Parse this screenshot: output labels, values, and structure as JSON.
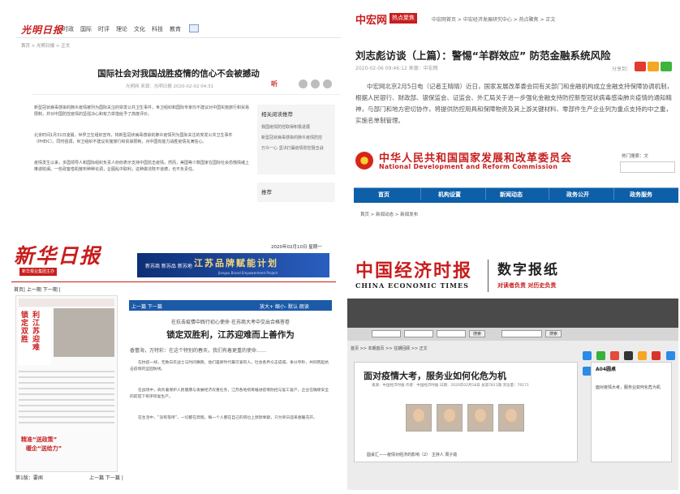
{
  "q1": {
    "logo": "光明日报",
    "nav": [
      "时政",
      "国际",
      "时评",
      "理论",
      "文化",
      "科技",
      "教育"
    ],
    "breadcrumb": "首页 > 光明日报 > 正文",
    "title": "国际社会对我国战胜疫情的信心不会被撼动",
    "meta": "光明网   来源：光明日报   2020-02-02 04:31",
    "listen": "听",
    "body": [
      "新型冠状病毒感染的肺炎疫情被列为国际关注的突发公共卫生事件，世卫组织和国际专家均不建议对中国实施旅行和贸易限制，并对中国防控疫情的坚强决心和有力举措给予了高度评价。",
      "北京时间1月31日凌晨，世界卫生组织宣布，将新型冠状病毒感染的肺炎疫情列为国际关注的突发公共卫生事件（PHEIC）。同时强调，世卫组织不建议实施旅行和贸易限制，对中国有能力战胜疫情充满信心。",
      "疫情发生以来，多国领导人和国际组织负责人纷纷表示支持中国抗击疫情。然而，美国等少数国家在国际社会恐慌情绪上推波助澜。一些政客借机散布种种论调，企图乱中取利，这种做法既不道德，也不负责任。"
    ],
    "sidebar_title": "相关阅读推荐",
    "sidebar_items": [
      "我国疫情防控取得积极进展",
      "新型冠状病毒感染的肺炎疫情防控",
      "万众一心 坚决打赢疫情防控阻击战"
    ],
    "sidebar_title2": "推荐"
  },
  "q2": {
    "logo": "中宏网",
    "hot_badge": "热点聚焦",
    "breadcrumb": "中宏网首页 > 中宏经济发展研究中心 > 热点聚焦 > 正文",
    "title": "刘志彪访谈（上篇）：警惕“羊群效应” 防范金融系统风险",
    "meta": "2020-02-06 09:46:12   来源：中宏网",
    "share_label": "分享到：",
    "paragraph": "中宏网北京2月5日电（记者王晴晴）近日，国家发展改革委会同有关部门和金融机构成立金融支持保障协调机制，根据人民银行、财政部、银保监会、证监会、外汇局关于进一步强化金融支持防控新型冠状病毒感染肺炎疫情的通知精神，与部门和地方密切协作，将提供防控用具和保障物资及其上游关键材料、零部件生产企业列为重点支持的中之重，实施名单制管理。",
    "ndrc_cn": "中华人民共和国国家发展和改革委员会",
    "ndrc_en": "National Development and Reform Commission",
    "hot_search": "热门搜索：文",
    "nav": [
      "首页",
      "机构设置",
      "新闻动态",
      "政务公开",
      "政务服务"
    ],
    "breadcrumb2": "首页 > 新闻动态 > 新闻发布"
  },
  "q3": {
    "logo": "新华日报",
    "logo_sub": "新华报业集团主办",
    "date": "2020年02月10日  星期一",
    "ad_title": "江苏品牌赋能计划",
    "ad_left": "新苏商  新苏品  新苏地",
    "ad_sub": "Jiangsu Brand Empowerment Project",
    "page_nav": "首页| 上一期  下一期 |",
    "thumb_title1": "锁定双胜",
    "thumb_title2": "利江苏迎难",
    "thumb_bottom1": "精准“送政策”",
    "thumb_bottom2": "暖企“送给力”",
    "article_nav_left": "上一篇  下一篇",
    "article_nav_right": "放大+  缩小-  默认  朗读",
    "kicker": "在抗击疫情中践行初心使命  在苏商大考中交出合格答卷",
    "title": "锁定双胜利，江苏迎难而上善作为",
    "author": "香蕾海，万特彩：在这个特别的春天，我们有着更重的使命……",
    "paras": [
      "在抗疫一线，无数白衣战士与时间赛跑，他们是新时代最可爱的人。社会各界众志成城，争分夺秒，共同筑起抗击疫情的坚固防线。",
      "在战场中，肩负着保护人民健康与发展经济双重任务，江苏各地统筹推进疫情防控与复工复产，企业在确保安全的前提下有序恢复生产。",
      "在生活中，“没有等待”，一切都在奔跑。每一个人都在自己的岗位上默默奉献，只为早日迎来春暖花开。"
    ],
    "footer_left": "第1版：要闻",
    "footer_right": "上一篇  下一篇 |"
  },
  "q4": {
    "logo": "中国经济时报",
    "logo_en": "CHINA ECONOMIC TIMES",
    "digital": "数字报纸",
    "slogan": "对读者负责  对历史负责",
    "search_btn": "搜索",
    "breadcrumb": "首页 >> 本期首页 >> 往期回顾 >> 正文",
    "title": "面对疫情大考，服务业如何化危为机",
    "meta": "来源：中国经济时报   作者：中国经济时报   日期：2020年02月18日   总第7811期   浏览量：70171",
    "caption": "圆桌汇——疫情对经济的影响（2）  主持人 周子勋",
    "side_heading": "A04圆桌",
    "side_item": "面对疫情大考，服务业如何化危为机"
  }
}
